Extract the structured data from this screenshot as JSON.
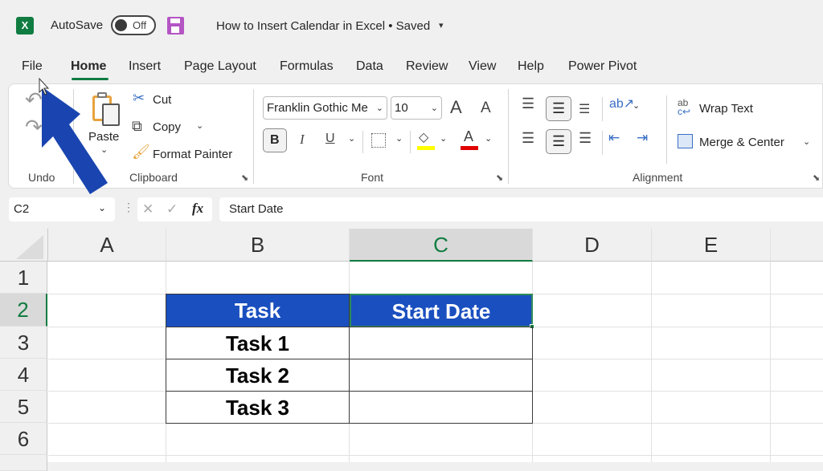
{
  "titlebar": {
    "app_icon": "excel-logo-icon",
    "app_letter": "X",
    "autosave_label": "AutoSave",
    "autosave_state": "Off",
    "save_icon": "save-icon",
    "document_title": "How to Insert Calendar in Excel • Saved",
    "title_dropdown_icon": "▾"
  },
  "tabs": [
    {
      "label": "File",
      "active": false
    },
    {
      "label": "Home",
      "active": true
    },
    {
      "label": "Insert",
      "active": false
    },
    {
      "label": "Page Layout",
      "active": false
    },
    {
      "label": "Formulas",
      "active": false
    },
    {
      "label": "Data",
      "active": false
    },
    {
      "label": "Review",
      "active": false
    },
    {
      "label": "View",
      "active": false
    },
    {
      "label": "Help",
      "active": false
    },
    {
      "label": "Power Pivot",
      "active": false
    }
  ],
  "ribbon": {
    "undo": {
      "group_label": "Undo",
      "undo_icon": "↶",
      "redo_icon": "↷"
    },
    "clipboard": {
      "group_label": "Clipboard",
      "paste_label": "Paste",
      "cut_label": "Cut",
      "copy_label": "Copy",
      "format_painter_label": "Format Painter",
      "chevron": "⌄"
    },
    "font": {
      "group_label": "Font",
      "font_name": "Franklin Gothic Me",
      "font_size": "10",
      "grow_icon": "A",
      "shrink_icon": "A",
      "bold": "B",
      "italic": "I",
      "underline": "U",
      "fill_color": "#ffff00",
      "font_color": "#e00000",
      "font_color_letter": "A"
    },
    "alignment": {
      "group_label": "Alignment",
      "wrap_text_label": "Wrap Text",
      "merge_center_label": "Merge & Center",
      "wrap_icon_text": "ab"
    }
  },
  "formula_bar": {
    "name_box": "C2",
    "cancel_icon": "✕",
    "enter_icon": "✓",
    "fx_label": "fx",
    "formula_value": "Start Date"
  },
  "grid": {
    "columns": [
      "A",
      "B",
      "C",
      "D",
      "E"
    ],
    "selected_column": "C",
    "rows": [
      "1",
      "2",
      "3",
      "4",
      "5",
      "6"
    ],
    "selected_row": "2",
    "active_cell": "C2",
    "table": {
      "header_color": "#1a4fbf",
      "headers": [
        "Task",
        "Start Date"
      ],
      "rows": [
        [
          "Task 1",
          ""
        ],
        [
          "Task 2",
          ""
        ],
        [
          "Task 3",
          ""
        ]
      ]
    }
  },
  "annotation": {
    "arrow_color": "#1a45b0",
    "points_to": "File"
  }
}
